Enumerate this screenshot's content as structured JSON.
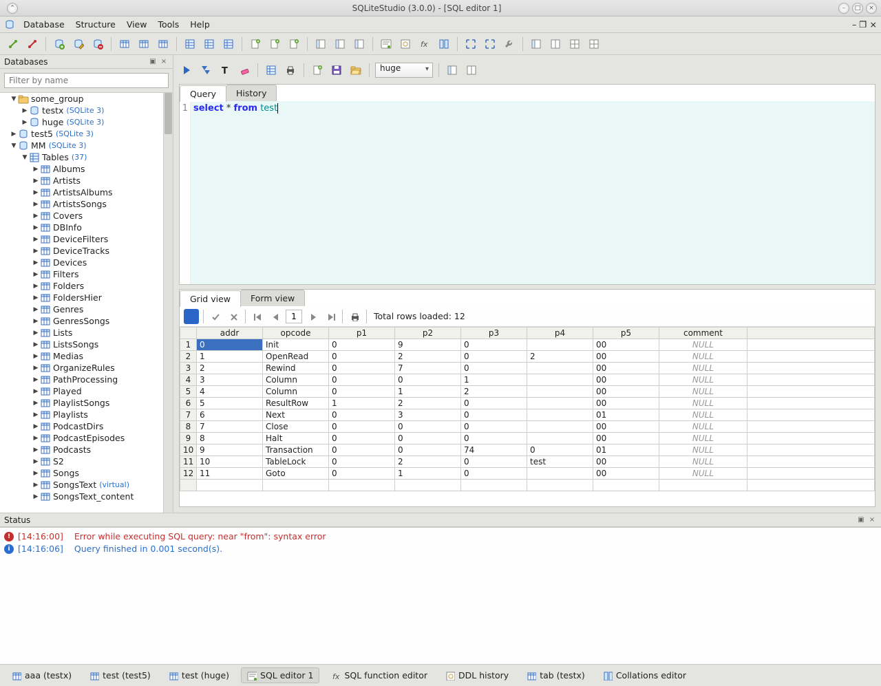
{
  "window": {
    "title": "SQLiteStudio (3.0.0) - [SQL editor 1]"
  },
  "menubar": [
    "Database",
    "Structure",
    "View",
    "Tools",
    "Help"
  ],
  "sidebar": {
    "title": "Databases",
    "filter_placeholder": "Filter by name",
    "tree": [
      {
        "d": 1,
        "arrow": "▼",
        "icon": "folder",
        "label": "some_group"
      },
      {
        "d": 2,
        "arrow": "▶",
        "icon": "db",
        "label": "testx",
        "suffix": "(SQLite 3)"
      },
      {
        "d": 2,
        "arrow": "▶",
        "icon": "db",
        "label": "huge",
        "suffix": "(SQLite 3)"
      },
      {
        "d": 1,
        "arrow": "▶",
        "icon": "db",
        "label": "test5",
        "suffix": "(SQLite 3)"
      },
      {
        "d": 1,
        "arrow": "▼",
        "icon": "db",
        "label": "MM",
        "suffix": "(SQLite 3)"
      },
      {
        "d": 2,
        "arrow": "▼",
        "icon": "tables",
        "label": "Tables",
        "suffix": "(37)"
      },
      {
        "d": 3,
        "arrow": "▶",
        "icon": "table",
        "label": "Albums"
      },
      {
        "d": 3,
        "arrow": "▶",
        "icon": "table",
        "label": "Artists"
      },
      {
        "d": 3,
        "arrow": "▶",
        "icon": "table",
        "label": "ArtistsAlbums"
      },
      {
        "d": 3,
        "arrow": "▶",
        "icon": "table",
        "label": "ArtistsSongs"
      },
      {
        "d": 3,
        "arrow": "▶",
        "icon": "table",
        "label": "Covers"
      },
      {
        "d": 3,
        "arrow": "▶",
        "icon": "table",
        "label": "DBInfo"
      },
      {
        "d": 3,
        "arrow": "▶",
        "icon": "table",
        "label": "DeviceFilters"
      },
      {
        "d": 3,
        "arrow": "▶",
        "icon": "table",
        "label": "DeviceTracks"
      },
      {
        "d": 3,
        "arrow": "▶",
        "icon": "table",
        "label": "Devices"
      },
      {
        "d": 3,
        "arrow": "▶",
        "icon": "table",
        "label": "Filters"
      },
      {
        "d": 3,
        "arrow": "▶",
        "icon": "table",
        "label": "Folders"
      },
      {
        "d": 3,
        "arrow": "▶",
        "icon": "table",
        "label": "FoldersHier"
      },
      {
        "d": 3,
        "arrow": "▶",
        "icon": "table",
        "label": "Genres"
      },
      {
        "d": 3,
        "arrow": "▶",
        "icon": "table",
        "label": "GenresSongs"
      },
      {
        "d": 3,
        "arrow": "▶",
        "icon": "table",
        "label": "Lists"
      },
      {
        "d": 3,
        "arrow": "▶",
        "icon": "table",
        "label": "ListsSongs"
      },
      {
        "d": 3,
        "arrow": "▶",
        "icon": "table",
        "label": "Medias"
      },
      {
        "d": 3,
        "arrow": "▶",
        "icon": "table",
        "label": "OrganizeRules"
      },
      {
        "d": 3,
        "arrow": "▶",
        "icon": "table",
        "label": "PathProcessing"
      },
      {
        "d": 3,
        "arrow": "▶",
        "icon": "table",
        "label": "Played"
      },
      {
        "d": 3,
        "arrow": "▶",
        "icon": "table",
        "label": "PlaylistSongs"
      },
      {
        "d": 3,
        "arrow": "▶",
        "icon": "table",
        "label": "Playlists"
      },
      {
        "d": 3,
        "arrow": "▶",
        "icon": "table",
        "label": "PodcastDirs"
      },
      {
        "d": 3,
        "arrow": "▶",
        "icon": "table",
        "label": "PodcastEpisodes"
      },
      {
        "d": 3,
        "arrow": "▶",
        "icon": "table",
        "label": "Podcasts"
      },
      {
        "d": 3,
        "arrow": "▶",
        "icon": "table",
        "label": "S2"
      },
      {
        "d": 3,
        "arrow": "▶",
        "icon": "table",
        "label": "Songs"
      },
      {
        "d": 3,
        "arrow": "▶",
        "icon": "table",
        "label": "SongsText",
        "virtual": "(virtual)"
      },
      {
        "d": 3,
        "arrow": "▶",
        "icon": "table",
        "label": "SongsText_content"
      }
    ]
  },
  "editor": {
    "tabs": {
      "query": "Query",
      "history": "History"
    },
    "db_selected": "huge",
    "sql_line_no": "1",
    "sql_kw_select": "select",
    "sql_star": " * ",
    "sql_kw_from": "from",
    "sql_sp": " ",
    "sql_ident": "test"
  },
  "results": {
    "tabs": {
      "grid": "Grid view",
      "form": "Form view"
    },
    "page_value": "1",
    "total_label": "Total rows loaded: 12",
    "columns": [
      "addr",
      "opcode",
      "p1",
      "p2",
      "p3",
      "p4",
      "p5",
      "comment"
    ],
    "rows": [
      [
        "0",
        "Init",
        "0",
        "9",
        "0",
        "",
        "00",
        null
      ],
      [
        "1",
        "OpenRead",
        "0",
        "2",
        "0",
        "2",
        "00",
        null
      ],
      [
        "2",
        "Rewind",
        "0",
        "7",
        "0",
        "",
        "00",
        null
      ],
      [
        "3",
        "Column",
        "0",
        "0",
        "1",
        "",
        "00",
        null
      ],
      [
        "4",
        "Column",
        "0",
        "1",
        "2",
        "",
        "00",
        null
      ],
      [
        "5",
        "ResultRow",
        "1",
        "2",
        "0",
        "",
        "00",
        null
      ],
      [
        "6",
        "Next",
        "0",
        "3",
        "0",
        "",
        "01",
        null
      ],
      [
        "7",
        "Close",
        "0",
        "0",
        "0",
        "",
        "00",
        null
      ],
      [
        "8",
        "Halt",
        "0",
        "0",
        "0",
        "",
        "00",
        null
      ],
      [
        "9",
        "Transaction",
        "0",
        "0",
        "74",
        "0",
        "01",
        null
      ],
      [
        "10",
        "TableLock",
        "0",
        "2",
        "0",
        "test",
        "00",
        null
      ],
      [
        "11",
        "Goto",
        "0",
        "1",
        "0",
        "",
        "00",
        null
      ]
    ]
  },
  "status": {
    "title": "Status",
    "messages": [
      {
        "type": "err",
        "time": "[14:16:00]",
        "text": "Error while executing SQL query: near \"from\": syntax error"
      },
      {
        "type": "info",
        "time": "[14:16:06]",
        "text": "Query finished in 0.001 second(s)."
      }
    ]
  },
  "bottom_tabs": [
    {
      "id": "aaa",
      "label": "aaa (testx)",
      "icon": "table"
    },
    {
      "id": "t5",
      "label": "test (test5)",
      "icon": "table"
    },
    {
      "id": "th",
      "label": "test (huge)",
      "icon": "table"
    },
    {
      "id": "sql1",
      "label": "SQL editor 1",
      "icon": "sql",
      "active": true
    },
    {
      "id": "fx",
      "label": "SQL function editor",
      "icon": "fx"
    },
    {
      "id": "ddl",
      "label": "DDL history",
      "icon": "ddl"
    },
    {
      "id": "tabx",
      "label": "tab (testx)",
      "icon": "table"
    },
    {
      "id": "coll",
      "label": "Collations editor",
      "icon": "coll"
    }
  ],
  "null_text": "NULL"
}
